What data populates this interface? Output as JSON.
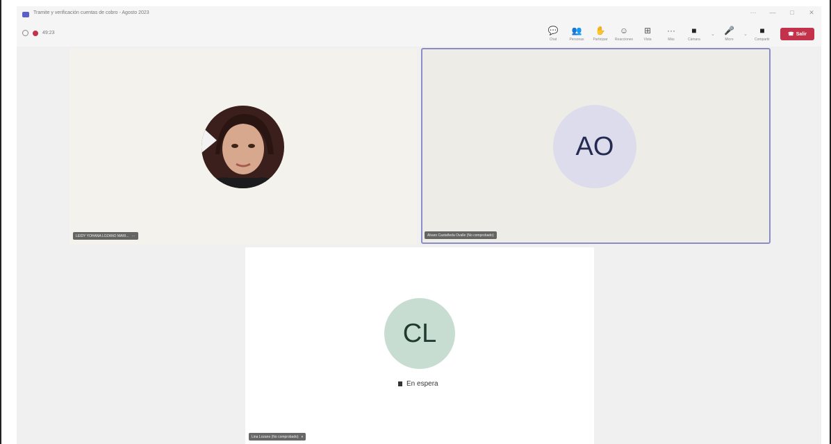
{
  "window": {
    "title": "Tramite y verificación cuentas de cobro - Agosto 2023",
    "controls": [
      "···",
      "—",
      "□",
      "✕"
    ]
  },
  "toolbar": {
    "timer": "49:23",
    "items": [
      {
        "icon": "chat-icon",
        "glyph": "💬",
        "label": "Chat"
      },
      {
        "icon": "people-icon",
        "glyph": "👥",
        "label": "Personas"
      },
      {
        "icon": "raise-hand-icon",
        "glyph": "✋",
        "label": "Participar"
      },
      {
        "icon": "reactions-icon",
        "glyph": "☺",
        "label": "Reacciones"
      },
      {
        "icon": "view-icon",
        "glyph": "⊞",
        "label": "Vista"
      },
      {
        "icon": "more-icon",
        "glyph": "···",
        "label": "Más"
      }
    ],
    "camera_label": "Cámara",
    "mic_label": "Micro",
    "share_label": "Compartir",
    "leave_label": "Salir"
  },
  "participants": [
    {
      "name": "LEIDY YOHANA LOZANO MARI...",
      "extra": "···",
      "type": "photo"
    },
    {
      "name": "Alvaro Castañeda Ovalle (No comprobado)",
      "initials": "AO",
      "type": "initials",
      "active": true
    },
    {
      "name": "Lina Lozano (No comprobado)",
      "initials": "CL",
      "type": "initials",
      "status": "En espera"
    }
  ],
  "colors": {
    "accent": "#5b5fc7",
    "leave": "#c4314b",
    "ao_avatar": "#dcdcec",
    "cl_avatar": "#c8ddd1"
  }
}
